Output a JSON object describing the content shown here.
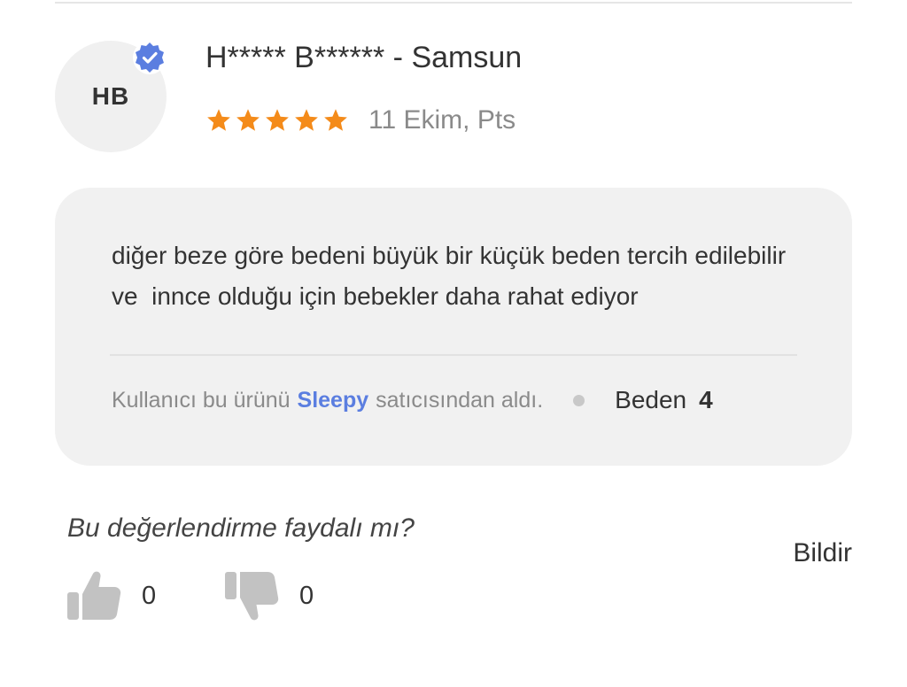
{
  "reviewer": {
    "initials": "HB",
    "name": "H***** B****** - Samsun",
    "verified": true
  },
  "rating": {
    "stars": 5,
    "max": 5,
    "date": "11 Ekim, Pts"
  },
  "review": {
    "text": "diğer beze göre bedeni büyük bir küçük beden tercih edilebilir ve  innce olduğu için bebekler daha rahat ediyor",
    "seller_prefix": "Kullanıcı bu ürünü",
    "seller_name": "Sleepy",
    "seller_suffix": "satıcısından aldı.",
    "size_label": "Beden",
    "size_value": "4"
  },
  "feedback": {
    "question": "Bu değerlendirme faydalı mı?",
    "report_label": "Bildir",
    "likes": "0",
    "dislikes": "0"
  },
  "icons": {
    "verified": "verified-check-icon",
    "star": "star-icon",
    "like": "thumbs-up-icon",
    "dislike": "thumbs-down-icon"
  },
  "colors": {
    "star": "#f48b1a",
    "verified": "#5b7ee0",
    "seller_link": "#5b7ee0",
    "card_bg": "#f1f1f1",
    "muted_text": "#8a8a8a",
    "vote_icon": "#c2c2c2"
  }
}
